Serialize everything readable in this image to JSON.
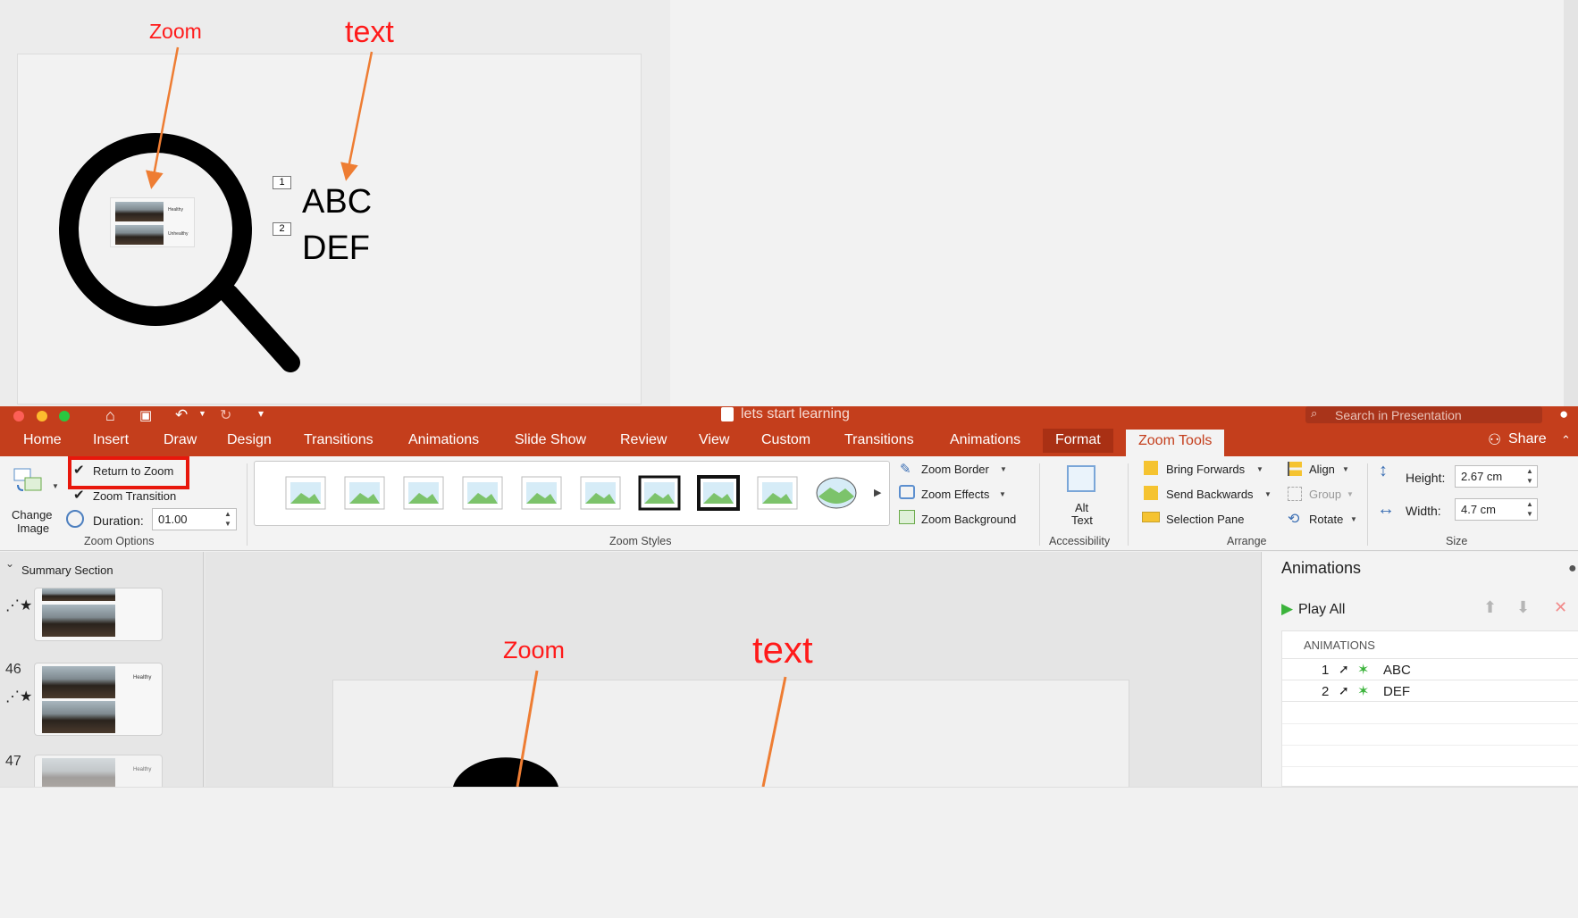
{
  "annotations": {
    "zoom_label": "Zoom",
    "text_label": "text"
  },
  "top_slide": {
    "items": [
      {
        "num": "1",
        "text": "ABC"
      },
      {
        "num": "2",
        "text": "DEF"
      }
    ],
    "thumb_caption_1": "Healthy",
    "thumb_caption_2": "Unhealthy"
  },
  "titlebar": {
    "title": "lets start learning",
    "search_placeholder": "Search in Presentation"
  },
  "tabs": [
    "Home",
    "Insert",
    "Draw",
    "Design",
    "Transitions",
    "Animations",
    "Slide Show",
    "Review",
    "View",
    "Custom",
    "Transitions",
    "Animations",
    "Format",
    "Zoom Tools"
  ],
  "share_label": "Share",
  "ribbon": {
    "change_image": "Change\nImage",
    "change_image_line1": "Change",
    "change_image_line2": "Image",
    "return_to_zoom": "Return to Zoom",
    "zoom_transition": "Zoom Transition",
    "duration_label": "Duration:",
    "duration_value": "01.00",
    "zoom_options_label": "Zoom Options",
    "zoom_styles_label": "Zoom Styles",
    "zoom_border": "Zoom Border",
    "zoom_effects": "Zoom Effects",
    "zoom_background": "Zoom Background",
    "alt_text_line1": "Alt",
    "alt_text_line2": "Text",
    "accessibility_label": "Accessibility",
    "bring_forwards": "Bring Forwards",
    "send_backwards": "Send Backwards",
    "selection_pane": "Selection Pane",
    "align": "Align",
    "group": "Group",
    "rotate": "Rotate",
    "arrange_label": "Arrange",
    "height_label": "Height:",
    "height_value": "2.67 cm",
    "width_label": "Width:",
    "width_value": "4.7 cm",
    "size_label": "Size"
  },
  "slides_panel": {
    "section_label": "Summary Section",
    "slide_numbers": [
      "46",
      "47"
    ],
    "thumb_caption": "Healthy"
  },
  "canvas": {
    "zoom_label": "Zoom",
    "text_label": "text"
  },
  "animations_pane": {
    "title": "Animations",
    "play_all": "Play All",
    "header": "ANIMATIONS",
    "items": [
      {
        "num": "1",
        "name": "ABC"
      },
      {
        "num": "2",
        "name": "DEF"
      }
    ]
  },
  "colors": {
    "ribbon_red": "#c43e1c",
    "annotation_red": "#ff1a1a",
    "annotation_orange": "#ee7d33",
    "highlight_box": "#e8170c",
    "play_green": "#3bb33b"
  }
}
